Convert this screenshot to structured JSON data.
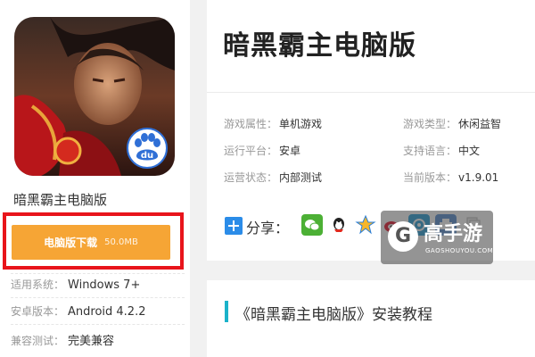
{
  "app": {
    "title": "暗黑霸主电脑版",
    "icon_badge": "du"
  },
  "download": {
    "label": "电脑版下载",
    "size": "50.0MB"
  },
  "specs": [
    {
      "label": "适用系统：",
      "value": "Windows 7+"
    },
    {
      "label": "安卓版本：",
      "value": "Android 4.2.2"
    },
    {
      "label": "兼容测试：",
      "value": "完美兼容"
    }
  ],
  "header": {
    "title": "暗黑霸主电脑版"
  },
  "attributes": [
    {
      "label": "游戏属性：",
      "value": "单机游戏"
    },
    {
      "label": "游戏类型：",
      "value": "休闲益智"
    },
    {
      "label": "运行平台：",
      "value": "安卓"
    },
    {
      "label": "支持语言：",
      "value": "中文"
    },
    {
      "label": "运营状态：",
      "value": "内部测试"
    },
    {
      "label": "当前版本：",
      "value": "v1.9.01"
    }
  ],
  "share": {
    "label": "分享：",
    "icons": [
      "wechat-icon",
      "qq-icon",
      "qzone-icon",
      "weibo-icon",
      "tencent-weibo-icon",
      "print-icon",
      "copy-icon"
    ]
  },
  "watermark": {
    "logo": "G",
    "name": "高手游",
    "sub": "GAOSHOUYOU.COM"
  },
  "section": {
    "title": "《暗黑霸主电脑版》安装教程"
  },
  "colors": {
    "download_button": "#f6a535",
    "highlight_frame": "#e8141b",
    "section_accent": "#1ab2c9"
  }
}
